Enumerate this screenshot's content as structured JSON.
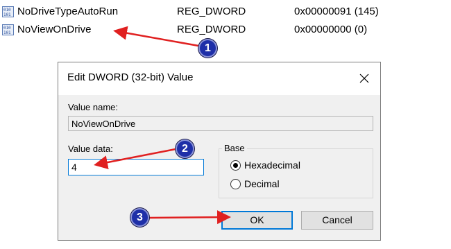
{
  "registry_rows": [
    {
      "name": "NoDriveTypeAutoRun",
      "type": "REG_DWORD",
      "data": "0x00000091 (145)",
      "icon": "registry-binary-icon"
    },
    {
      "name": "NoViewOnDrive",
      "type": "REG_DWORD",
      "data": "0x00000000 (0)",
      "icon": "registry-binary-icon"
    }
  ],
  "dialog": {
    "title": "Edit DWORD (32-bit) Value",
    "value_name_label": "Value name:",
    "value_name": "NoViewOnDrive",
    "value_data_label": "Value data:",
    "value_data": "4",
    "base_label": "Base",
    "base_options": [
      {
        "label": "Hexadecimal",
        "selected": true
      },
      {
        "label": "Decimal",
        "selected": false
      }
    ],
    "ok_label": "OK",
    "cancel_label": "Cancel",
    "close_icon": "close-icon"
  },
  "callouts": [
    "1",
    "2",
    "3"
  ],
  "colors": {
    "arrow": "#e02020",
    "callout": "#1e2fa8",
    "focus": "#0078d7"
  }
}
